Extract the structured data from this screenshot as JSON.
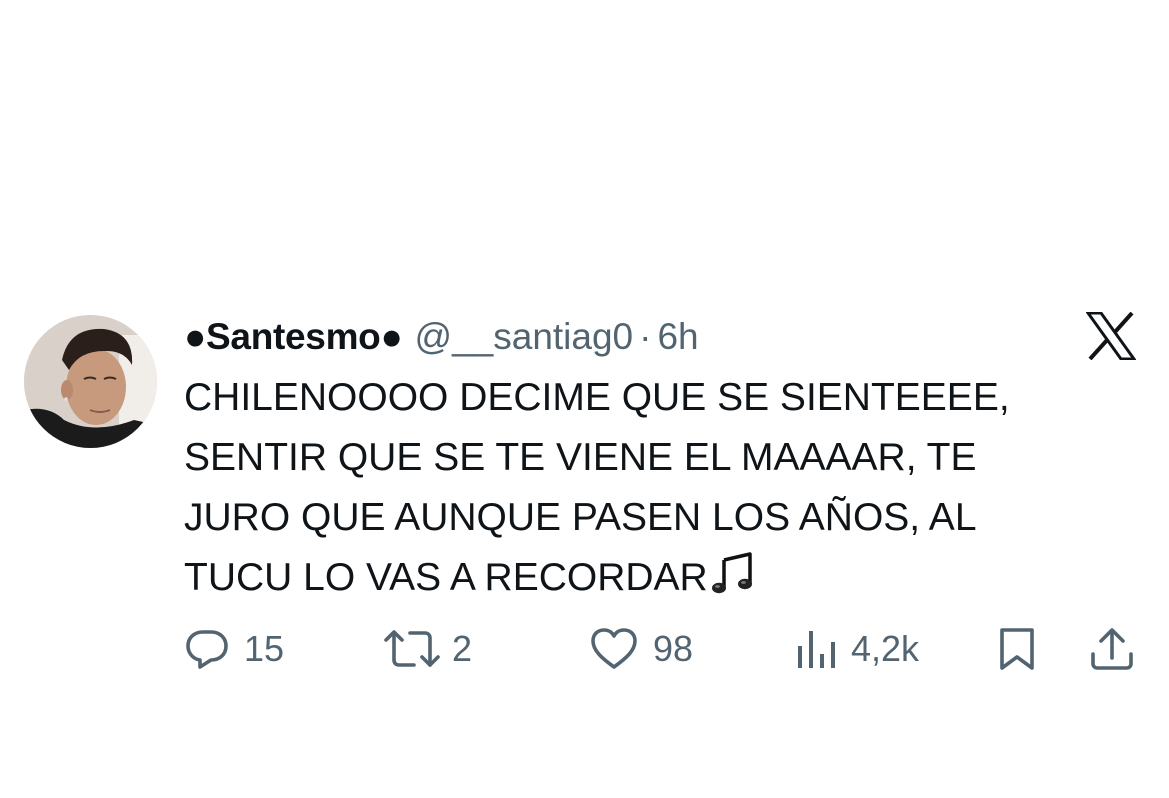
{
  "tweet": {
    "display_name": "●Santesmo●",
    "handle": "@__santiag0",
    "separator": "·",
    "time": "6h",
    "text_lines": [
      "CHILENOOOO DECIME QUE SE SIENTEEEE,",
      "SENTIR QUE SE TE VIENE EL MAAAAR, TE",
      "JURO QUE AUNQUE PASEN LOS AÑOS, AL",
      "TUCU LO VAS A RECORDAR"
    ],
    "trailing_icon": "musical-notes-icon"
  },
  "stats": {
    "replies": "15",
    "reposts": "2",
    "likes": "98",
    "views": "4,2k"
  },
  "icons": {
    "platform": "x-logo-icon",
    "reply": "reply-icon",
    "repost": "repost-icon",
    "like": "heart-icon",
    "views": "views-icon",
    "bookmark": "bookmark-icon",
    "share": "share-icon"
  },
  "colors": {
    "text_primary": "#0f1419",
    "text_secondary": "#536471",
    "background": "#ffffff"
  }
}
